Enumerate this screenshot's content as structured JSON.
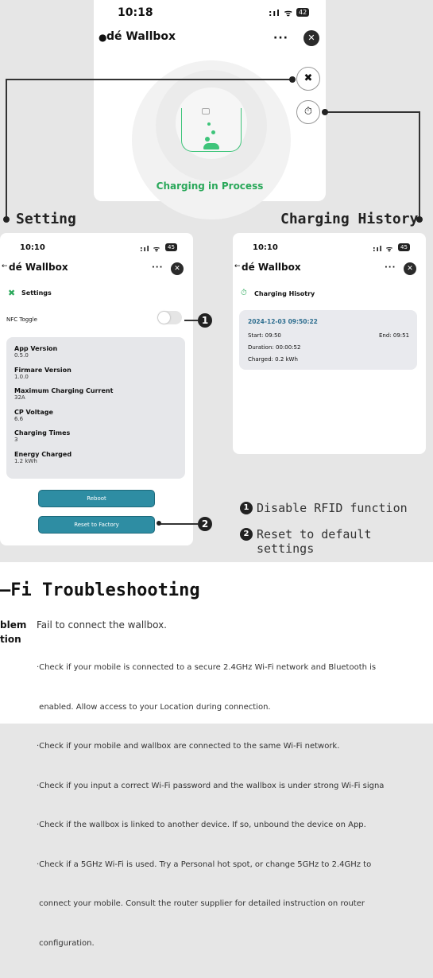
{
  "top_phone": {
    "time": "10:18",
    "signal": ":ıl ᯤ",
    "battery": "42",
    "app_title": "dé Wallbox",
    "more": "···",
    "close": "✕",
    "status": "Charging in Process"
  },
  "labels": {
    "setting": "Setting",
    "history": "Charging History"
  },
  "settings_phone": {
    "time": "10:10",
    "signal": ":ıl ᯤ",
    "battery": "45",
    "back": "←",
    "app_title": "dé Wallbox",
    "more": "···",
    "close": "✕",
    "section": "Settings",
    "nfc_label": "NFC Toggle",
    "info": [
      {
        "label": "App Version",
        "value": "0.5.0"
      },
      {
        "label": "Firmare Version",
        "value": "1.0.0"
      },
      {
        "label": "Maximum Charging Current",
        "value": "32A"
      },
      {
        "label": "CP Voltage",
        "value": "6.6"
      },
      {
        "label": "Charging Times",
        "value": "3"
      },
      {
        "label": "Energy Charged",
        "value": "1.2 kWh"
      }
    ],
    "reboot": "Reboot",
    "reset": "Reset to Factory"
  },
  "history_phone": {
    "time": "10:10",
    "signal": ":ıl ᯤ",
    "battery": "45",
    "back": "←",
    "app_title": "dé Wallbox",
    "more": "···",
    "close": "✕",
    "section": "Charging Hisotry",
    "record": {
      "date": "2024-12-03 09:50:22",
      "start": "Start: 09:50",
      "end": "End: 09:51",
      "duration": "Duration: 00:00:52",
      "charged": "Charged: 0.2 kWh"
    }
  },
  "legend": {
    "n1": "1",
    "n2": "2",
    "item1": "Disable RFID function",
    "item2": "Reset to default settings"
  },
  "troubleshoot": {
    "title": "–Fi Troubleshooting",
    "problem_label": "blem",
    "problem_text": "Fail to connect the wallbox.",
    "solution_label": "tion",
    "bullets": [
      "·Check if your mobile is connected to a secure 2.4GHz Wi-Fi network and Bluetooth is",
      " enabled. Allow access to your Location during connection.",
      "·Check if your mobile and wallbox are connected to the same Wi-Fi network.",
      "·Check if you input a correct Wi-Fi password and the wallbox is under strong Wi-Fi signa",
      "·Check if the wallbox is linked to another device. If so, unbound the device on App.",
      "·Check if a 5GHz Wi-Fi is used. Try a Personal hot spot, or change 5GHz to 2.4GHz to",
      " connect your mobile. Consult the router supplier for detailed instruction on router",
      " configuration."
    ]
  },
  "colors": {
    "accent_green": "#2aa85a",
    "button_teal": "#2e8da3",
    "date_blue": "#2e6e8f"
  }
}
